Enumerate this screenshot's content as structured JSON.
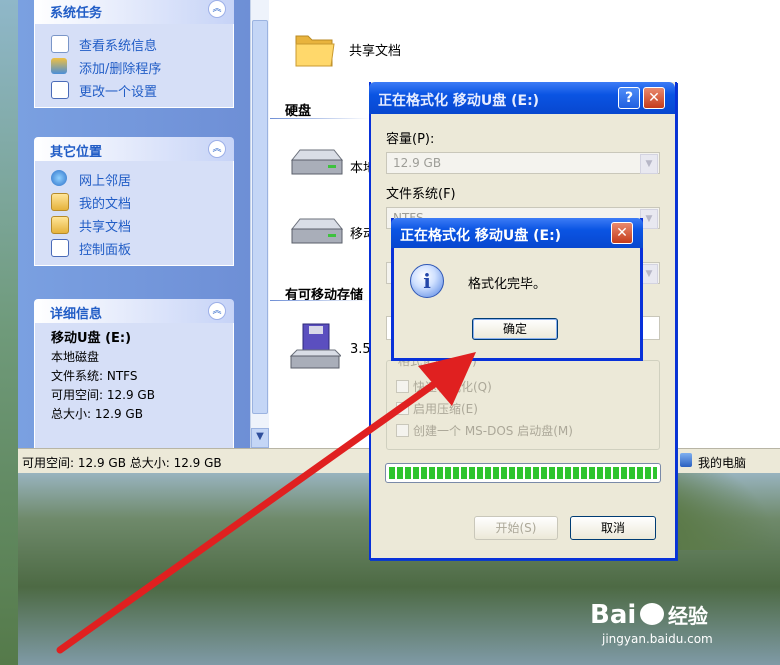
{
  "left_pane": {
    "system_tasks": {
      "title": "系统任务",
      "items": [
        {
          "label": "查看系统信息",
          "icon": "system-info-icon"
        },
        {
          "label": "添加/删除程序",
          "icon": "add-remove-programs-icon"
        },
        {
          "label": "更改一个设置",
          "icon": "change-setting-icon"
        }
      ]
    },
    "other_places": {
      "title": "其它位置",
      "items": [
        {
          "label": "网上邻居",
          "icon": "network-places-icon"
        },
        {
          "label": "我的文档",
          "icon": "my-documents-icon"
        },
        {
          "label": "共享文档",
          "icon": "shared-documents-icon"
        },
        {
          "label": "控制面板",
          "icon": "control-panel-icon"
        }
      ]
    },
    "details": {
      "title": "详细信息",
      "name": "移动U盘  (E:)",
      "type": "本地磁盘",
      "filesystem": "文件系统: NTFS",
      "free": "可用空间: 12.9 GB",
      "total": "总大小: 12.9 GB"
    }
  },
  "content": {
    "shared_folder_label": "共享文档",
    "hard_disks_header": "硬盘",
    "drive1_label": "本地",
    "drive2_label": "移动",
    "removable_header": "有可移动存储",
    "floppy_label": "3.5"
  },
  "status_bar": {
    "text": "可用空间: 12.9 GB 总大小: 12.9 GB",
    "location": "我的电脑"
  },
  "format_dialog": {
    "title": "正在格式化 移动U盘 (E:)",
    "help_label": "?",
    "close_label": "✕",
    "capacity_label": "容量(P):",
    "capacity_value": "12.9 GB",
    "filesystem_label": "文件系统(F)",
    "filesystem_value": "NTFS",
    "options_label": "格式化选项(O)",
    "quick_format": "快速格式化(Q)",
    "enable_compression": "启用压缩(E)",
    "ms_dos_disk": "创建一个 MS-DOS 启动盘(M)",
    "progress": 1.0,
    "start_button": "开始(S)",
    "close_button": "取消"
  },
  "message_box": {
    "title": "正在格式化 移动U盘 (E:)",
    "close_label": "✕",
    "icon": "info-icon",
    "text": "格式化完毕。",
    "ok_button": "确定"
  },
  "watermark": {
    "brand": "Bai",
    "brand2": "经验",
    "url": "jingyan.baidu.com"
  },
  "colors": {
    "xp_blue": "#0a54e3",
    "panel_text": "#215dc6",
    "arrow": "#e02020"
  }
}
